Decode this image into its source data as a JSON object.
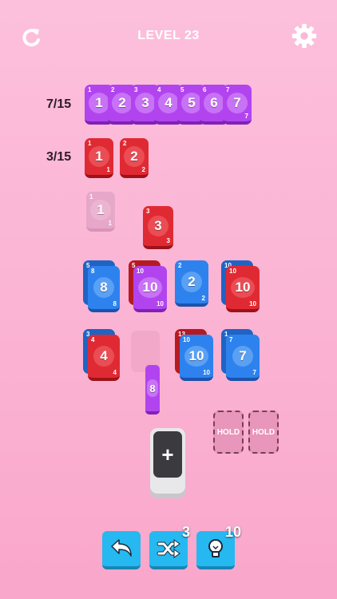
{
  "header": {
    "title": "LEVEL 23",
    "restart_icon": "restart-icon",
    "settings_icon": "gear-icon"
  },
  "goals": [
    {
      "count": "7/15",
      "color": "purple",
      "cards": [
        "1",
        "2",
        "3",
        "4",
        "5",
        "6",
        "7"
      ]
    },
    {
      "count": "3/15",
      "color": "red",
      "cards": [
        "1",
        "2"
      ]
    }
  ],
  "board": {
    "ghost_card": "1",
    "loose_card": "3",
    "stacks": [
      {
        "top": "8",
        "under": "5",
        "color": "blue",
        "under_color": "blue"
      },
      {
        "top": "10",
        "under": "5",
        "color": "purple",
        "under_color": "red"
      },
      {
        "top": "2",
        "under": "",
        "color": "blue",
        "under_color": "blue"
      },
      {
        "top": "10",
        "under": "10",
        "color": "red",
        "under_color": "blue"
      },
      {
        "top": "4",
        "under": "3",
        "color": "red",
        "under_color": "blue"
      },
      {
        "top": "10",
        "under": "13",
        "color": "blue",
        "under_color": "red"
      },
      {
        "top": "7",
        "under": "1",
        "color": "blue",
        "under_color": "blue"
      }
    ],
    "edge_card": "8"
  },
  "hold": {
    "slot1": "HOLD",
    "slot2": "HOLD"
  },
  "dispenser": {
    "label": "+"
  },
  "toolbar": {
    "undo_icon": "undo-icon",
    "shuffle_icon": "shuffle-icon",
    "shuffle_count": "3",
    "hint_icon": "lightbulb-icon",
    "hint_count": "10"
  },
  "colors": {
    "purple": "#b244f0",
    "red": "#e02a33",
    "blue": "#2d82ee",
    "button": "#26b8f0"
  }
}
